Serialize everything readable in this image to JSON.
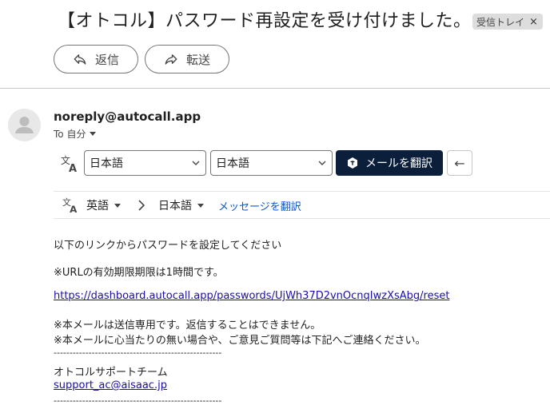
{
  "subject": "【オトコル】パスワード再設定を受け付けました。",
  "label_chip": {
    "label": "受信トレイ",
    "remove": "×"
  },
  "actions": {
    "reply": "返信",
    "forward": "転送"
  },
  "sender": {
    "email": "noreply@autocall.app",
    "to": "To 自分"
  },
  "translate_bar": {
    "source_lang": "日本語",
    "target_lang": "日本語",
    "translate_button": "メールを翻訳",
    "back_button": "←"
  },
  "translate_bar2": {
    "from": "英語",
    "to": "日本語",
    "link": "メッセージを翻訳"
  },
  "body": {
    "line1": "以下のリンクからパスワードを設定してください",
    "line2": "※URLの有効期限期限は1時間です。",
    "reset_link": "https://dashboard.autocall.app/passwords/UjWh37D2vnOcnqIwzXsAbg/reset",
    "note1": "※本メールは送信専用です。返信することはできません。",
    "note2": "※本メールに心当たりの無い場合や、ご意見ご質問等は下記へご連絡ください。",
    "separator": "-----------------------------------------------------",
    "team": "オトコルサポートチーム",
    "support_email": "support_ac@aisaac.jp"
  },
  "colors": {
    "translate_button_bg": "#0b1f3a",
    "link": "#1a0dab",
    "accent_link": "#0b57d0"
  }
}
